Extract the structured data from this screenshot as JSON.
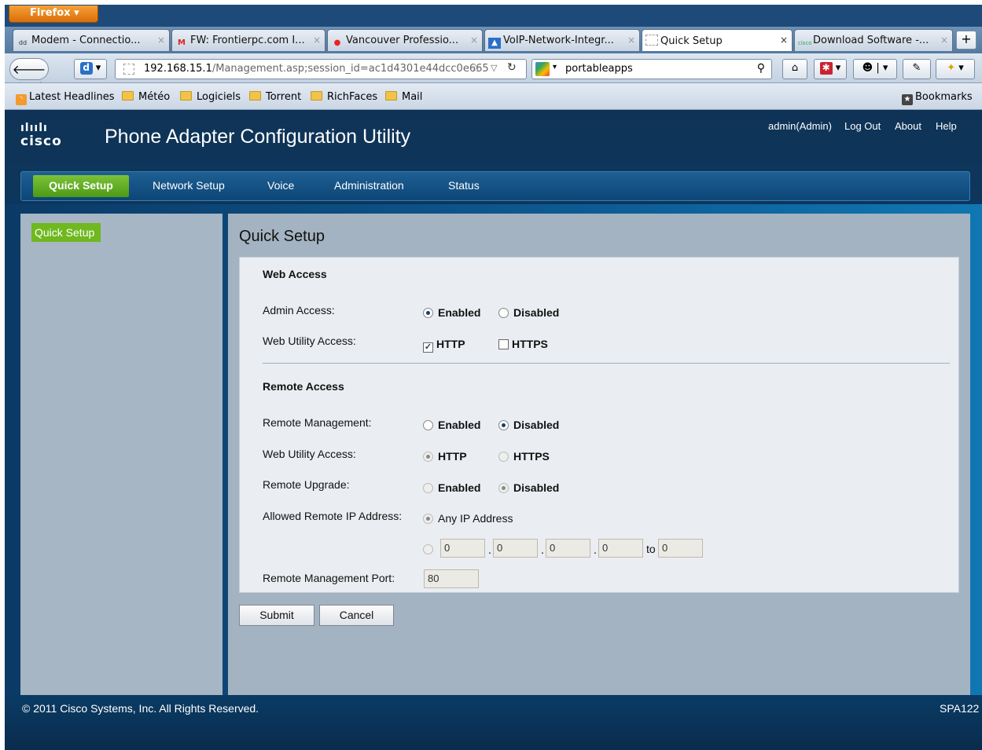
{
  "browser": {
    "app_button": "Firefox",
    "tabs": [
      {
        "label": "Modem - Connectio...",
        "icon": "ddwrt-icon"
      },
      {
        "label": "FW: Frontierpc.com I...",
        "icon": "gmail-icon"
      },
      {
        "label": "Vancouver Professio...",
        "icon": "vancouver-icon"
      },
      {
        "label": "VoIP-Network-Integr...",
        "icon": "voip-icon"
      },
      {
        "label": "Quick Setup",
        "icon": "blank-page-icon",
        "active": true
      },
      {
        "label": "Download Software -...",
        "icon": "cisco-icon"
      }
    ],
    "url": {
      "host": "192.168.15.1",
      "path": "/Management.asp;session_id=ac1d4301e44dcc0e665"
    },
    "search_value": "portableapps",
    "bookmarks": [
      "Latest Headlines",
      "Météo",
      "Logiciels",
      "Torrent",
      "RichFaces",
      "Mail"
    ],
    "bookmarks_menu": "Bookmarks"
  },
  "header": {
    "logo_text": "cisco",
    "title": "Phone Adapter Configuration Utility",
    "user": "admin(Admin)",
    "logout": "Log Out",
    "about": "About",
    "help": "Help"
  },
  "menu": [
    "Quick Setup",
    "Network Setup",
    "Voice",
    "Administration",
    "Status"
  ],
  "sidebar": {
    "active": "Quick Setup"
  },
  "content": {
    "title": "Quick Setup",
    "web_access": {
      "heading": "Web Access",
      "admin_access_label": "Admin Access:",
      "enabled": "Enabled",
      "disabled": "Disabled",
      "web_utility_label": "Web Utility Access:",
      "http": "HTTP",
      "https": "HTTPS"
    },
    "remote_access": {
      "heading": "Remote Access",
      "remote_mgmt_label": "Remote Management:",
      "web_utility_label": "Web Utility Access:",
      "remote_upgrade_label": "Remote Upgrade:",
      "allowed_ip_label": "Allowed Remote IP Address:",
      "any_ip": "Any IP Address",
      "ip": [
        "0",
        "0",
        "0",
        "0"
      ],
      "to_label": "to",
      "to_value": "0",
      "dot": ".",
      "port_label": "Remote Management Port:",
      "port_value": "80"
    },
    "submit": "Submit",
    "cancel": "Cancel"
  },
  "footer": {
    "copyright": "© 2011 Cisco Systems, Inc. All Rights Reserved.",
    "model": "SPA122"
  },
  "colors": {
    "accent_green": "#6fb820",
    "header_blue": "#0f3356"
  }
}
